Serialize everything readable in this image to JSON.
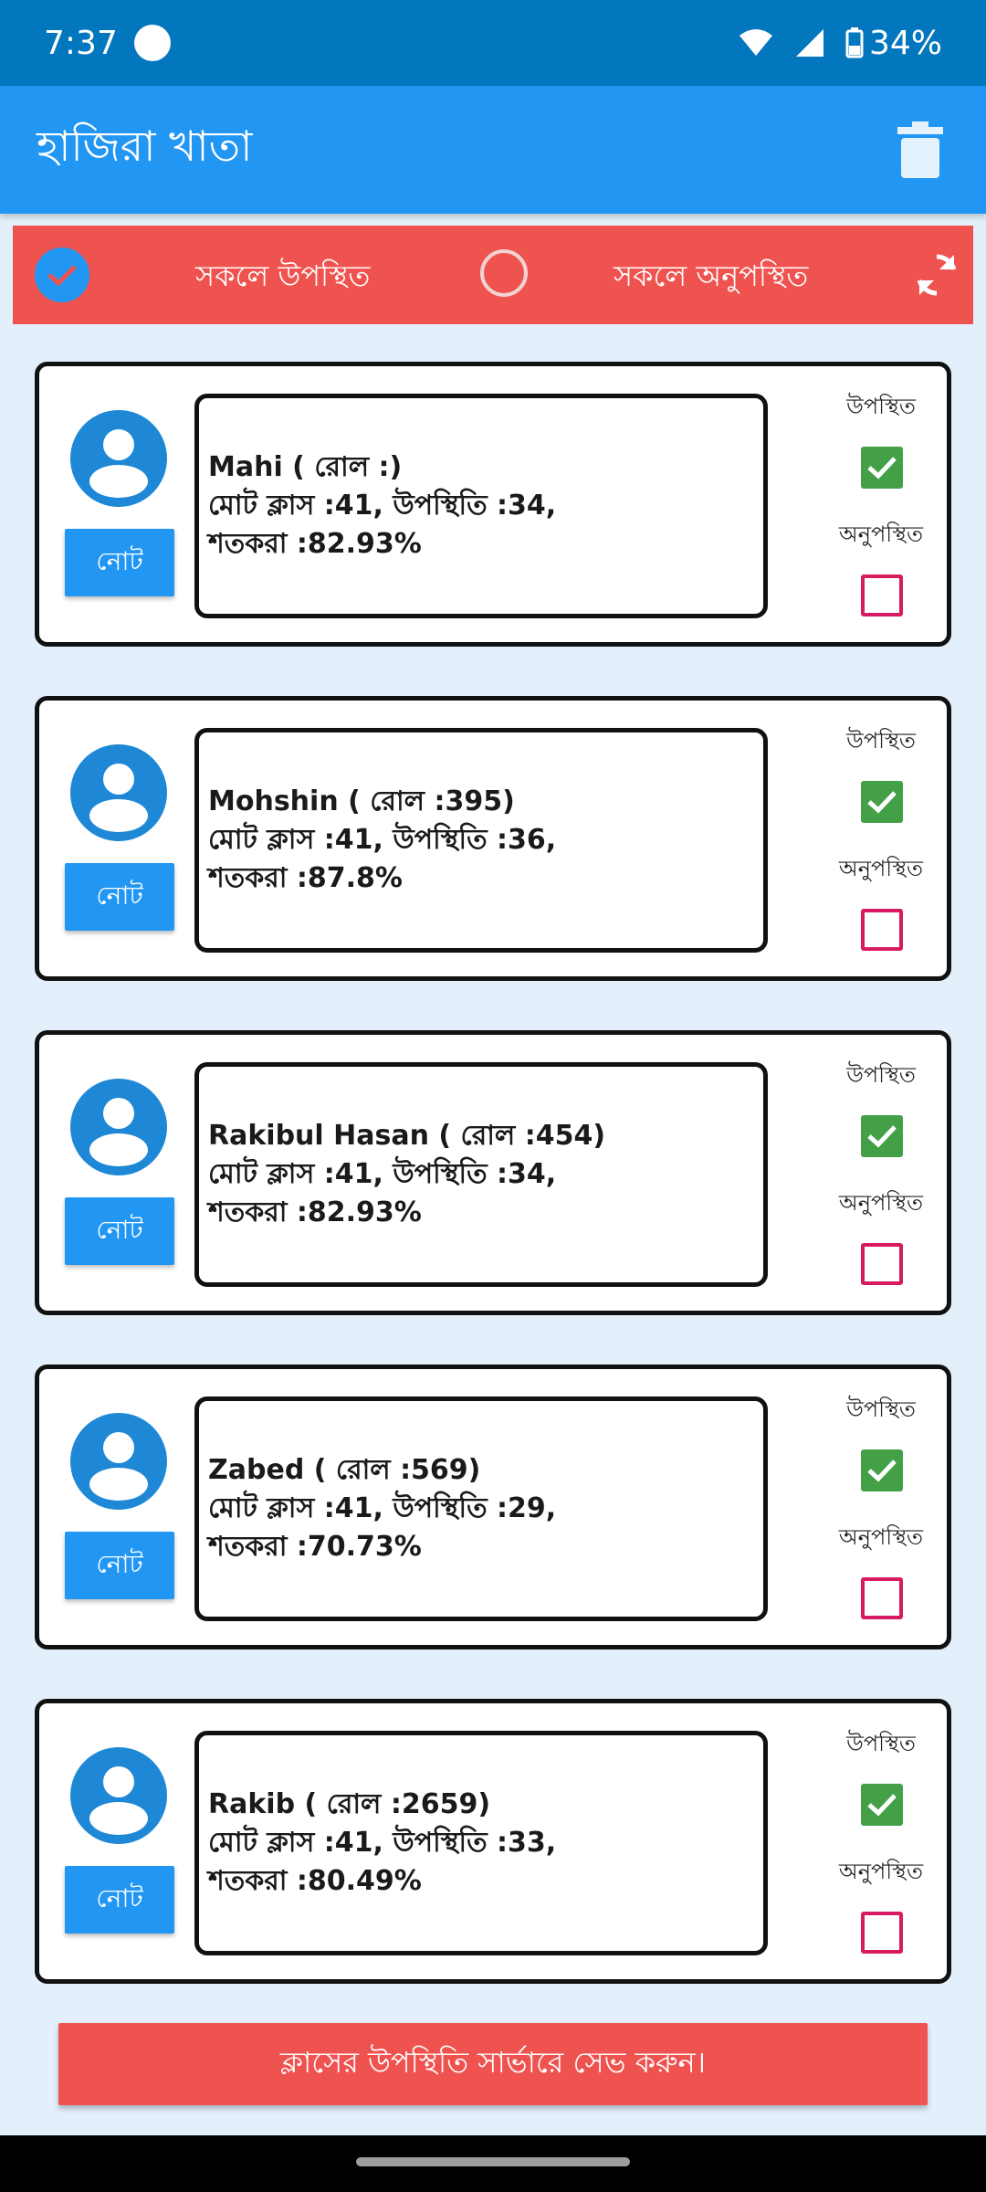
{
  "status_bar": {
    "time": "7:37",
    "battery": "34%",
    "icons": [
      "app-notification-icon",
      "wifi-icon",
      "signal-icon",
      "battery-icon"
    ]
  },
  "app_bar": {
    "title": "হাজিরা খাতা",
    "trash_icon": "trash-icon"
  },
  "bulk": {
    "all_present_label": "সকলে উপস্থিত",
    "all_absent_label": "সকলে অনুপস্থিত",
    "all_present_selected": true,
    "refresh_icon": "refresh-icon"
  },
  "students": [
    {
      "name_line": "Mahi ( রোল :)",
      "classes_line": "মোট ক্লাস :41, উপস্থিতি :34,",
      "percent_line": "শতকরা :82.93%",
      "note_label": "নোট",
      "present_label": "উপস্থিত",
      "absent_label": "অনুপস্থিত",
      "present": true
    },
    {
      "name_line": "Mohshin ( রোল :395)",
      "classes_line": "মোট ক্লাস :41, উপস্থিতি :36,",
      "percent_line": "শতকরা :87.8%",
      "note_label": "নোট",
      "present_label": "উপস্থিত",
      "absent_label": "অনুপস্থিত",
      "present": true
    },
    {
      "name_line": "Rakibul Hasan ( রোল :454)",
      "classes_line": "মোট ক্লাস :41, উপস্থিতি :34,",
      "percent_line": "শতকরা :82.93%",
      "note_label": "নোট",
      "present_label": "উপস্থিত",
      "absent_label": "অনুপস্থিত",
      "present": true
    },
    {
      "name_line": "Zabed ( রোল :569)",
      "classes_line": "মোট ক্লাস :41, উপস্থিতি :29,",
      "percent_line": "শতকরা :70.73%",
      "note_label": "নোট",
      "present_label": "উপস্থিত",
      "absent_label": "অনুপস্থিত",
      "present": true
    },
    {
      "name_line": "Rakib ( রোল :2659)",
      "classes_line": "মোট ক্লাস :41, উপস্থিতি :33,",
      "percent_line": "শতকরা :80.49%",
      "note_label": "নোট",
      "present_label": "উপস্থিত",
      "absent_label": "অনুপস্থিত",
      "present": true
    }
  ],
  "save_button": {
    "label": "ক্লাসের উপস্থিতি সার্ভারে সেভ করুন।"
  },
  "colors": {
    "status_bar": "#0277bd",
    "app_bar": "#2196f3",
    "accent_red": "#ef5350",
    "present_green": "#43a047",
    "absent_pink": "#d81b60",
    "background": "#e3f0fb"
  }
}
